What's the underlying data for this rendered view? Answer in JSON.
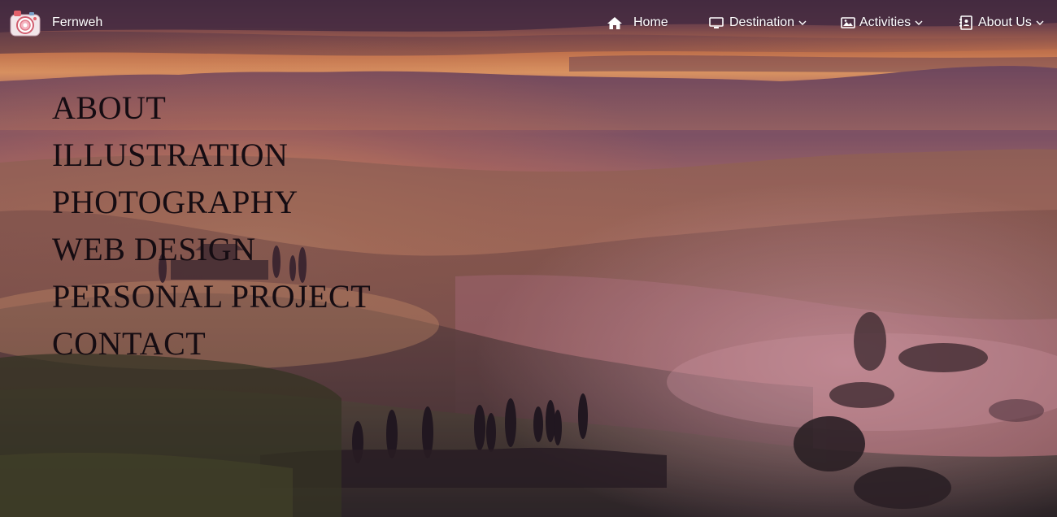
{
  "brand": {
    "name": "Fernweh",
    "logo_icon": "camera-logo-icon"
  },
  "nav": {
    "home": {
      "label": "Home",
      "icon": "home-icon"
    },
    "destination": {
      "label": "Destination",
      "icon": "monitor-icon"
    },
    "activities": {
      "label": "Activities",
      "icon": "image-icon"
    },
    "about": {
      "label": "About Us",
      "icon": "contact-book-icon"
    }
  },
  "side_menu": {
    "items": [
      {
        "label": "ABOUT"
      },
      {
        "label": "ILLUSTRATION"
      },
      {
        "label": "PHOTOGRAPHY"
      },
      {
        "label": "WEB DESIGN"
      },
      {
        "label": "PERSONAL PROJECT"
      },
      {
        "label": "CONTACT"
      }
    ]
  },
  "colors": {
    "nav_text": "#ffffff",
    "menu_text": "#150c12",
    "sky_top": "#3e2a4a",
    "sky_glow": "#f09a5c",
    "hills_dark": "#2e2330"
  }
}
